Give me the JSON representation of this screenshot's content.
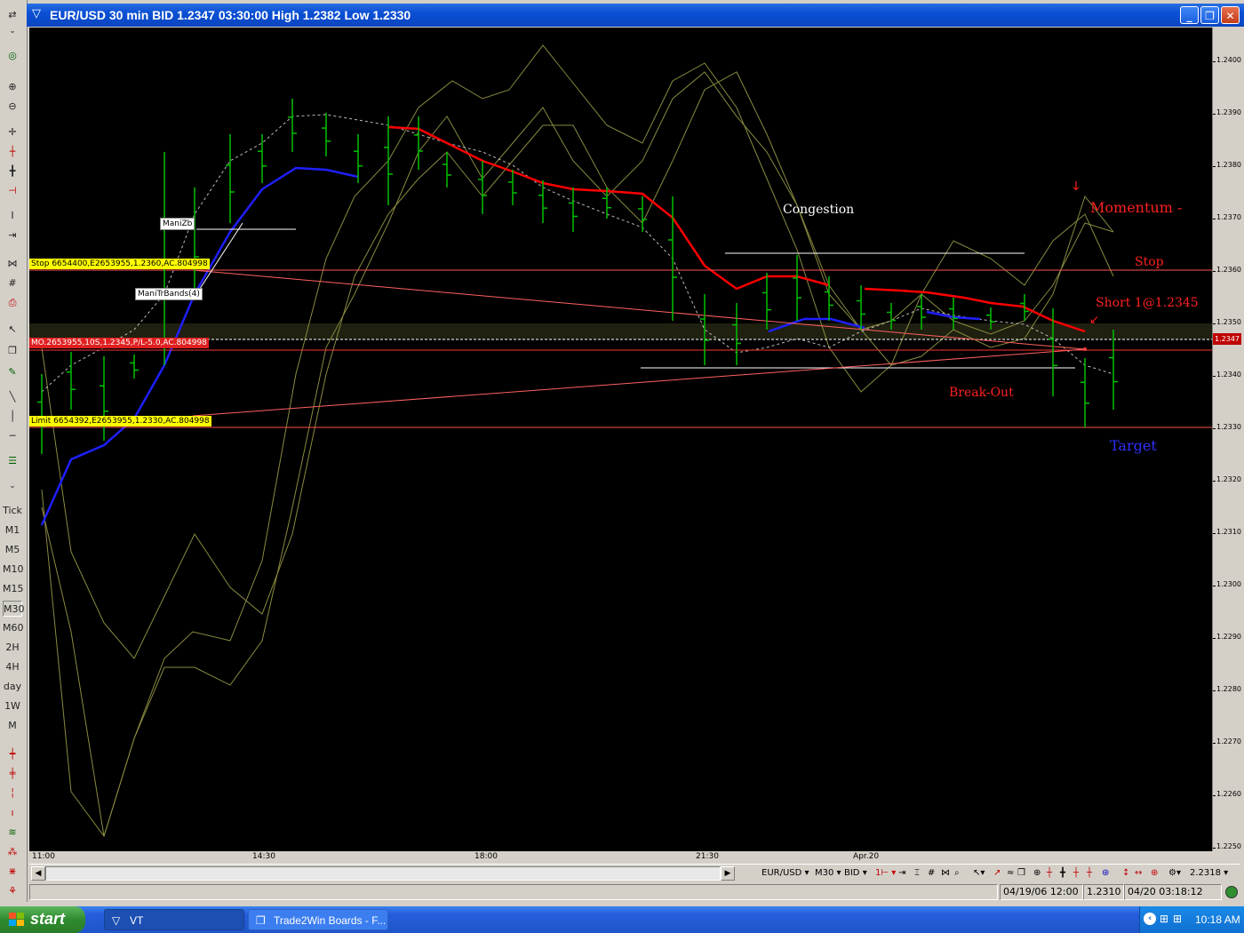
{
  "window": {
    "title": "EUR/USD 30 min BID 1.2347 03:30:00 High 1.2382 Low 1.2330",
    "buttons": {
      "minimize": "_",
      "restore": "❐",
      "close": "✕"
    }
  },
  "left_toolbar": {
    "timeframes": [
      "Tick",
      "M1",
      "M5",
      "M10",
      "M15",
      "M30",
      "M60",
      "2H",
      "4H",
      "day",
      "1W",
      "M"
    ],
    "active_timeframe": "M30"
  },
  "chart": {
    "price_axis_ticks": [
      "1.2400",
      "1.2390",
      "1.2380",
      "1.2370",
      "1.2360",
      "1.2350",
      "1.2340",
      "1.2330",
      "1.2320",
      "1.2310",
      "1.2300",
      "1.2290",
      "1.2280",
      "1.2270",
      "1.2260",
      "1.2250"
    ],
    "current_price": "1.2347",
    "time_axis_labels": [
      "11:00",
      "14:30",
      "18:00",
      "21:30",
      "Apr.20"
    ],
    "order_labels": {
      "stop": "Stop 6654400,E2653955,1.2360,AC.804998",
      "mo": "MO.2653955,10S,1.2345,P/L-5.0,AC.804998",
      "limit": "Limit 6654392,E2653955,1.2330,AC.804998"
    },
    "indicator_labels": {
      "manizb": "ManiZb",
      "manitrbands": "ManiTrBands(4)"
    },
    "annotations": {
      "congestion": "Congestion",
      "momentum": "Momentum -",
      "stop": "Stop",
      "short": "Short 1@1.2345",
      "breakout": "Break-Out",
      "target": "Target"
    },
    "colors": {
      "bars": "#00c000",
      "red_line": "#ff0000",
      "blue_line": "#1f1fff",
      "olive_line": "#8a8a40",
      "order_line": "#ff4040",
      "label_yellow": "#ffff00",
      "annotation_red": "#ff2020",
      "annotation_blue": "#3030ff"
    }
  },
  "bottom_toolbar": {
    "symbol": "EUR/USD",
    "period": "M30",
    "side": "BID",
    "lots": "1",
    "price_value": "2.2318"
  },
  "status_bar": {
    "cursor_time": "04/19/06 12:00",
    "cursor_price": "1.2310",
    "server_time": "04/20 03:18:12"
  },
  "taskbar": {
    "start_label": "start",
    "tasks": [
      "VT",
      "Trade2Win Boards - F..."
    ],
    "clock": "10:18 AM"
  }
}
